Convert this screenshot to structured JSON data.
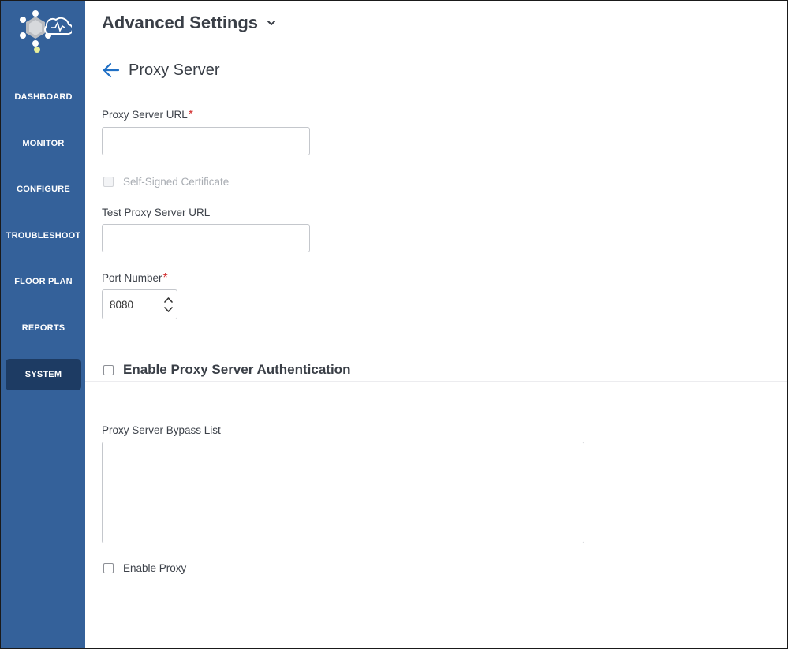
{
  "sidebar": {
    "items": [
      {
        "label": "DASHBOARD"
      },
      {
        "label": "MONITOR"
      },
      {
        "label": "CONFIGURE"
      },
      {
        "label": "TROUBLESHOOT"
      },
      {
        "label": "FLOOR PLAN"
      },
      {
        "label": "REPORTS"
      },
      {
        "label": "SYSTEM",
        "active": true
      }
    ]
  },
  "header": {
    "title": "Advanced Settings",
    "chevron_icon": "chevron-down-icon"
  },
  "subheader": {
    "back_icon": "arrow-left-icon",
    "title": "Proxy Server"
  },
  "form": {
    "proxy_url": {
      "label": "Proxy Server URL",
      "required_mark": "*",
      "value": "",
      "placeholder": ""
    },
    "self_signed": {
      "label": "Self-Signed Certificate",
      "checked": false,
      "disabled": true
    },
    "test_url": {
      "label": "Test Proxy Server URL",
      "value": "",
      "placeholder": ""
    },
    "port": {
      "label": "Port Number",
      "required_mark": "*",
      "value": "8080"
    },
    "auth": {
      "label": "Enable Proxy Server Authentication",
      "checked": false
    },
    "bypass": {
      "label": "Proxy Server Bypass List",
      "value": ""
    },
    "enable_proxy": {
      "label": "Enable Proxy",
      "checked": false
    }
  },
  "colors": {
    "sidebar_bg": "#34619a",
    "sidebar_active": "#1d3b63",
    "accent_blue": "#1f6fc5",
    "required_red": "#d32f2f"
  }
}
